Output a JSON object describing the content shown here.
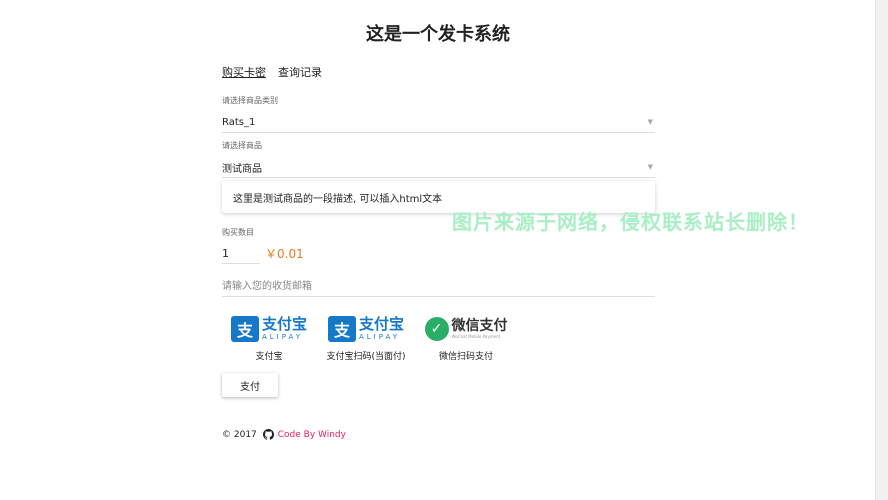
{
  "page": {
    "title": "这是一个发卡系统"
  },
  "tabs": [
    {
      "label": "购买卡密"
    },
    {
      "label": "查询记录"
    }
  ],
  "category": {
    "label": "请选择商品类别",
    "value": "Rats_1"
  },
  "product": {
    "label": "请选择商品",
    "value": "测试商品"
  },
  "description": "这里是测试商品的一段描述, 可以插入html文本",
  "quantity": {
    "label": "购买数目",
    "value": "1",
    "price": "￥0.01"
  },
  "email": {
    "placeholder": "请输入您的收货邮箱"
  },
  "payment_methods": [
    {
      "logo_cn": "支付宝",
      "logo_en": "ALIPAY",
      "name": "支付宝"
    },
    {
      "logo_cn": "支付宝",
      "logo_en": "ALIPAY",
      "name": "支付宝扫码(当面付)"
    },
    {
      "logo_cn": "微信支付",
      "logo_en": "WeChat Mobile Payment",
      "name": "微信扫码支付"
    }
  ],
  "pay_button": "支付",
  "footer": {
    "copyright": "© 2017",
    "link_text": "Code By Windy"
  },
  "watermark": "图片来源于网络，侵权联系站长删除！",
  "colors": {
    "alipay_blue": "#1678c8",
    "wechat_green": "#2aae67",
    "price_orange": "#e67e22",
    "link_pink": "#e91e63"
  },
  "icons": [
    "github-icon",
    "alipay-logo-icon",
    "wechat-pay-logo-icon",
    "caret-down-icon"
  ]
}
